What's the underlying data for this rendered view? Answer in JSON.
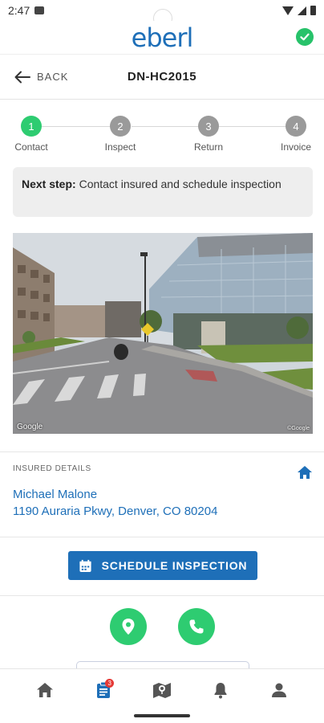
{
  "status_bar": {
    "time": "2:47"
  },
  "app_header": {
    "logo_text": "eberl",
    "brand_color": "#1e6fb8",
    "sync_status": "check-circle-icon"
  },
  "nav": {
    "back_label": "BACK",
    "claim_id": "DN-HC2015"
  },
  "stepper": {
    "steps": [
      {
        "number": "1",
        "label": "Contact",
        "active": true
      },
      {
        "number": "2",
        "label": "Inspect",
        "active": false
      },
      {
        "number": "3",
        "label": "Return",
        "active": false
      },
      {
        "number": "4",
        "label": "Invoice",
        "active": false
      }
    ],
    "active_color": "#2ecc71",
    "inactive_color": "#9a9a9a"
  },
  "next_step": {
    "prefix": "Next step:",
    "text": "Contact insured and schedule inspection"
  },
  "street_view": {
    "credit": "Google",
    "credit_right": "©Google"
  },
  "insured": {
    "section_label": "INSURED DETAILS",
    "name": "Michael Malone",
    "address": "1190 Auraria Pkwy, Denver, CO 80204"
  },
  "actions": {
    "schedule_label": "SCHEDULE INSPECTION",
    "map_icon": "map-pin-icon",
    "call_icon": "phone-icon"
  },
  "tabbar": {
    "tabs": [
      {
        "name": "home",
        "icon": "home-icon"
      },
      {
        "name": "claims",
        "icon": "clipboard-icon",
        "badge": "3",
        "active": true
      },
      {
        "name": "map",
        "icon": "map-icon"
      },
      {
        "name": "notifications",
        "icon": "bell-icon"
      },
      {
        "name": "profile",
        "icon": "person-icon"
      }
    ]
  }
}
